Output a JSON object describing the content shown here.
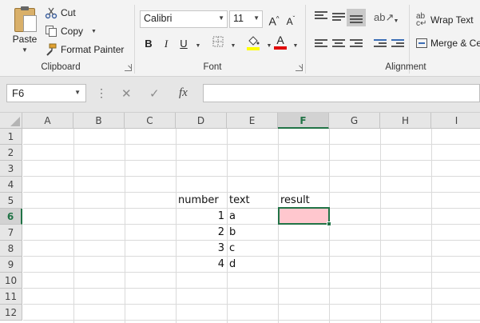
{
  "ribbon": {
    "clipboard": {
      "paste_label": "Paste",
      "cut_label": "Cut",
      "copy_label": "Copy",
      "format_painter_label": "Format Painter",
      "group_label": "Clipboard"
    },
    "font": {
      "font_name": "Calibri",
      "font_size": "11",
      "group_label": "Font",
      "fill_color": "#ffff00",
      "font_color": "#e00000"
    },
    "alignment": {
      "wrap_text_label": "Wrap Text",
      "merge_label": "Merge & Ce",
      "group_label": "Alignment"
    }
  },
  "formula_bar": {
    "name_box": "F6",
    "formula": ""
  },
  "sheet": {
    "columns": [
      "A",
      "B",
      "C",
      "D",
      "E",
      "F",
      "G",
      "H",
      "I"
    ],
    "rows": [
      "1",
      "2",
      "3",
      "4",
      "5",
      "6",
      "7",
      "8",
      "9",
      "10",
      "11",
      "12"
    ],
    "selected_column": "F",
    "selected_row": "6",
    "cells": {
      "D5": "number",
      "E5": "text",
      "F5": "result",
      "D6": "1",
      "E6": "a",
      "D7": "2",
      "E7": "b",
      "D8": "3",
      "E8": "c",
      "D9": "4",
      "E9": "d"
    },
    "active_cell_fill": "#ffc7ce",
    "accent": "#217346"
  }
}
